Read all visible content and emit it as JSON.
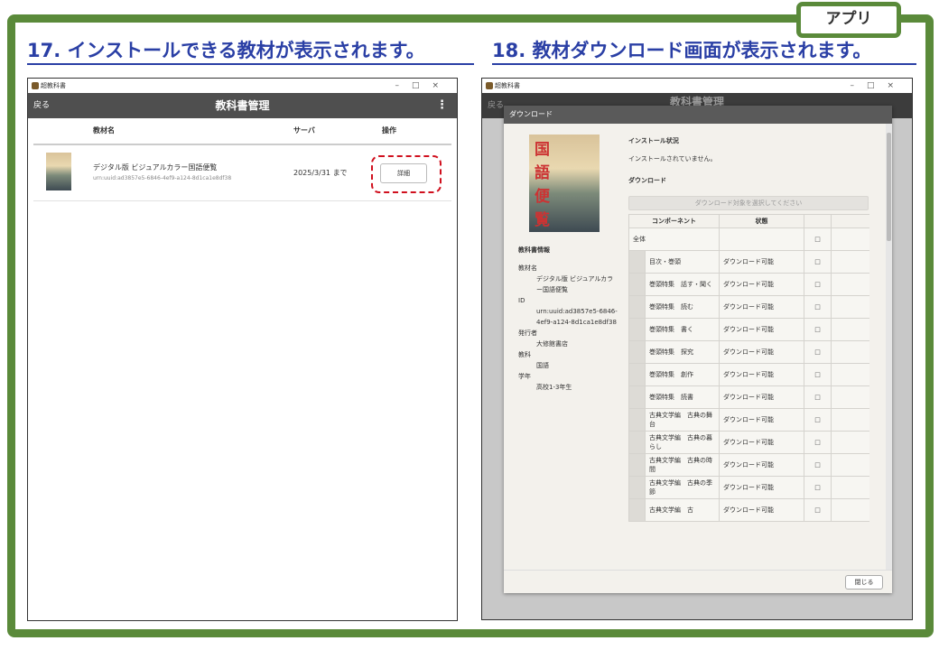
{
  "tag": "アプリ",
  "step17": {
    "heading": "17. インストールできる教材が表示されます。",
    "window_title": "超教科書",
    "app_title": "教科書管理",
    "back": "戻る",
    "more": "⋮",
    "columns": [
      "教材名",
      "サーバ",
      "操作"
    ],
    "row": {
      "name": "デジタル版 ビジュアルカラー国語便覧",
      "urn": "urn:uuid:ad3857e5-6846-4ef9-a124-8d1ca1e8df38",
      "server": "2025/3/31 まで",
      "detail": "詳細"
    },
    "window_controls": "–□×"
  },
  "step18": {
    "heading": "18. 教材ダウンロード画面が表示されます。",
    "window_title": "超教科書",
    "back": "戻る",
    "app_title": "教科書管理",
    "modal_title": "ダウンロード",
    "cover_title": "国語便覧",
    "info_header": "教科書情報",
    "info": [
      {
        "label": "教材名",
        "value": "デジタル版 ビジュアルカラー国語便覧"
      },
      {
        "label": "ID",
        "value": "urn:uuid:ad3857e5-6846-4ef9-a124-8d1ca1e8df38"
      },
      {
        "label": "発行者",
        "value": "大修館書店"
      },
      {
        "label": "教科",
        "value": "国語"
      },
      {
        "label": "学年",
        "value": "高校1-3年生"
      }
    ],
    "install_status_label": "インストール状況",
    "install_status_value": "インストールされていません。",
    "download_label": "ダウンロード",
    "select_placeholder": "ダウンロード対象を選択してください",
    "table_headers": [
      "コンポーネント",
      "状態"
    ],
    "all_label": "全体",
    "components": [
      {
        "name": "目次・巻頭",
        "status": "ダウンロード可能"
      },
      {
        "name": "巻頭特集　話す・聞く",
        "status": "ダウンロード可能"
      },
      {
        "name": "巻頭特集　読む",
        "status": "ダウンロード可能"
      },
      {
        "name": "巻頭特集　書く",
        "status": "ダウンロード可能"
      },
      {
        "name": "巻頭特集　探究",
        "status": "ダウンロード可能"
      },
      {
        "name": "巻頭特集　創作",
        "status": "ダウンロード可能"
      },
      {
        "name": "巻頭特集　読書",
        "status": "ダウンロード可能"
      },
      {
        "name": "古典文学編　古典の舞台",
        "status": "ダウンロード可能"
      },
      {
        "name": "古典文学編　古典の暮らし",
        "status": "ダウンロード可能"
      },
      {
        "name": "古典文学編　古典の時間",
        "status": "ダウンロード可能"
      },
      {
        "name": "古典文学編　古典の季節",
        "status": "ダウンロード可能"
      },
      {
        "name": "古典文学編　古",
        "status": "ダウンロード可能"
      }
    ],
    "checkbox_glyph": "□",
    "close": "閉じる"
  }
}
